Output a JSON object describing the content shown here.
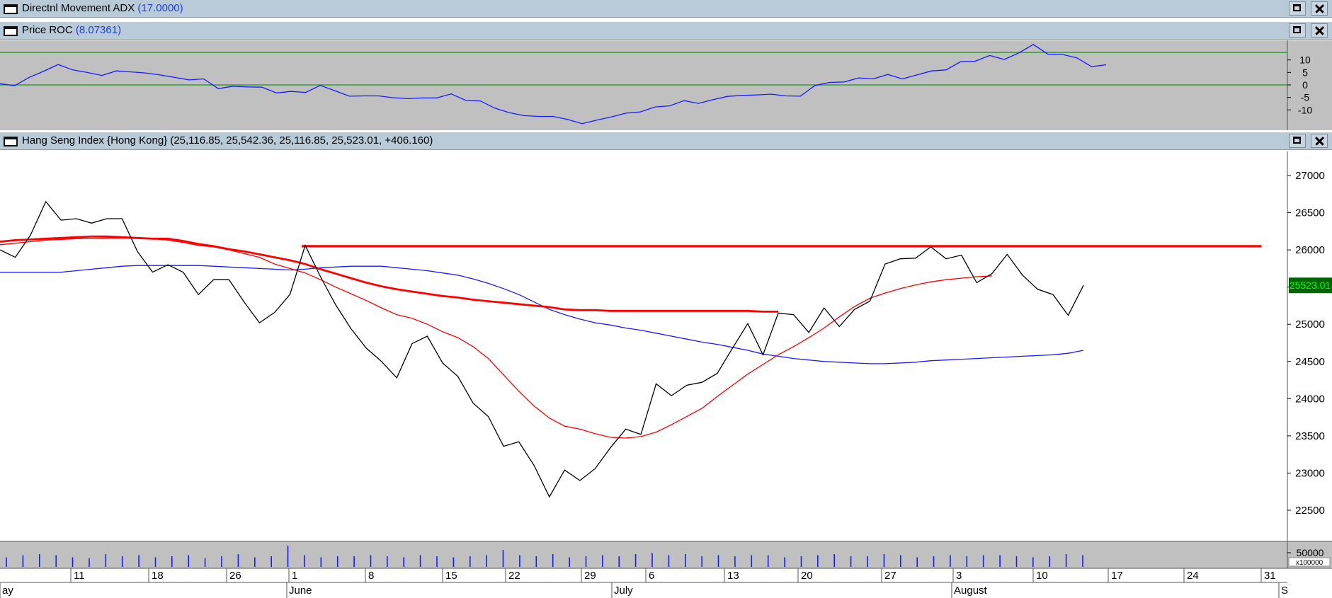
{
  "panes": [
    {
      "title": "Directnl Movement ADX",
      "value": "(17.0000)"
    },
    {
      "title": "Price ROC",
      "value": "(8.07361)"
    },
    {
      "title": "Hang Seng Index {Hong Kong}",
      "value": " (25,116.85, 25,542.36, 25,116.85, 25,523.01, +406.160)"
    }
  ],
  "colors": {
    "price": "#000000",
    "ma_blue": "#1a1aff",
    "ma_red": "#ff0000",
    "roc": "#1a1aff",
    "roc_bands": "#1f8f1f",
    "pane_bg_indicator": "#c0c0c0",
    "last_price_badge": "#006400",
    "last_price_text": "#00ff00"
  },
  "chart_data": [
    {
      "type": "line",
      "title": "Price ROC",
      "ylim": [
        -17,
        17
      ],
      "y_ticks": [
        "10",
        "5",
        "0",
        "-5",
        "-10"
      ],
      "reference_lines": [
        13,
        0
      ],
      "series": [
        {
          "values": [
            0.5,
            -0.3,
            3,
            5.5,
            8.2,
            6,
            5,
            3.8,
            5.6,
            5.2,
            4.8,
            4,
            3,
            2,
            2.4,
            -1.5,
            -0.5,
            -0.8,
            -0.9,
            -3.2,
            -2.6,
            -3,
            -0.2,
            -2.3,
            -4.5,
            -4.4,
            -4.4,
            -5.1,
            -5.5,
            -5.2,
            -5.2,
            -3.6,
            -6.2,
            -6.4,
            -9.3,
            -11.1,
            -12.3,
            -12.6,
            -12.6,
            -13.8,
            -15.5,
            -14.1,
            -12.8,
            -11.3,
            -10.8,
            -8.8,
            -8.4,
            -6.3,
            -7.4,
            -5.9,
            -4.6,
            -4.2,
            -4,
            -3.7,
            -4.4,
            -4.5,
            -0.2,
            1,
            1.2,
            2.8,
            2.4,
            4.2,
            2.4,
            4,
            5.6,
            6,
            9.3,
            9.5,
            11.8,
            10.2,
            12.8,
            16.2,
            12.3,
            12.2,
            10.8,
            7.3,
            8.07
          ]
        }
      ]
    },
    {
      "type": "line",
      "title": "Hang Seng Index {Hong Kong}",
      "ylim": [
        22050,
        27350
      ],
      "y_ticks": [
        "27000",
        "26500",
        "26000",
        "25500",
        "25000",
        "24500",
        "24000",
        "23500",
        "23000",
        "22500"
      ],
      "last_value_label": "25523.01",
      "series": [
        {
          "name": "Close",
          "values": [
            26000,
            25900,
            26200,
            26650,
            26400,
            26420,
            26360,
            26420,
            26420,
            25980,
            25700,
            25800,
            25700,
            25400,
            25600,
            25600,
            25300,
            25020,
            25160,
            25400,
            26060,
            25640,
            25260,
            24940,
            24680,
            24500,
            24280,
            24740,
            24840,
            24480,
            24300,
            23940,
            23760,
            23360,
            23420,
            23100,
            22680,
            23040,
            22900,
            23060,
            23340,
            23590,
            23520,
            24200,
            24040,
            24180,
            24220,
            24340,
            24680,
            25010,
            24590,
            25150,
            25130,
            24890,
            25220,
            24970,
            25200,
            25310,
            25810,
            25880,
            25890,
            26040,
            25880,
            25930,
            25560,
            25680,
            25940,
            25660,
            25470,
            25400,
            25120,
            25523
          ]
        },
        {
          "name": "MA blue",
          "values": [
            25700,
            25700,
            25700,
            25700,
            25700,
            25720,
            25740,
            25760,
            25780,
            25790,
            25790,
            25790,
            25790,
            25790,
            25780,
            25770,
            25760,
            25750,
            25740,
            25730,
            25740,
            25760,
            25770,
            25780,
            25780,
            25780,
            25760,
            25740,
            25720,
            25690,
            25660,
            25610,
            25550,
            25480,
            25400,
            25300,
            25200,
            25130,
            25070,
            25020,
            24990,
            24950,
            24920,
            24880,
            24840,
            24800,
            24760,
            24730,
            24690,
            24650,
            24600,
            24570,
            24540,
            24520,
            24500,
            24490,
            24480,
            24470,
            24470,
            24480,
            24490,
            24510,
            24520,
            24530,
            24540,
            24550,
            24560,
            24570,
            24580,
            24590,
            24610,
            24650
          ]
        },
        {
          "name": "MA red thin",
          "values": [
            26070,
            26090,
            26110,
            26130,
            26140,
            26150,
            26150,
            26160,
            26160,
            26160,
            26150,
            26130,
            26100,
            26060,
            26040,
            26000,
            25950,
            25900,
            25810,
            25750,
            25690,
            25600,
            25500,
            25410,
            25320,
            25220,
            25130,
            25080,
            25000,
            24900,
            24820,
            24700,
            24540,
            24320,
            24100,
            23900,
            23740,
            23630,
            23590,
            23530,
            23480,
            23470,
            23490,
            23550,
            23650,
            23760,
            23870,
            24030,
            24180,
            24330,
            24460,
            24590,
            24700,
            24820,
            24950,
            25100,
            25240,
            25350,
            25420,
            25480,
            25530,
            25570,
            25600,
            25620,
            25640,
            25650
          ]
        },
        {
          "name": "MA red thick",
          "values": [
            26110,
            26130,
            26140,
            26150,
            26160,
            26170,
            26180,
            26180,
            26170,
            26160,
            26150,
            26150,
            26120,
            26080,
            26050,
            26010,
            25980,
            25940,
            25900,
            25860,
            25810,
            25740,
            25680,
            25620,
            25560,
            25510,
            25470,
            25440,
            25410,
            25380,
            25360,
            25330,
            25310,
            25290,
            25270,
            25250,
            25230,
            25200,
            25190,
            25190,
            25180,
            25180,
            25180,
            25180,
            25180,
            25180,
            25180,
            25180,
            25180,
            25180,
            25170,
            25170
          ]
        },
        {
          "name": "Resistance",
          "values": [
            26050,
            26050
          ]
        }
      ]
    },
    {
      "type": "bar",
      "title": "Volume",
      "y_tick": "50000",
      "scale_label": "x100000",
      "values": [
        0.45,
        0.55,
        0.6,
        0.55,
        0.45,
        0.4,
        0.6,
        0.5,
        0.55,
        0.45,
        0.5,
        0.55,
        0.4,
        0.5,
        0.6,
        0.45,
        0.5,
        1.0,
        0.55,
        0.45,
        0.5,
        0.5,
        0.55,
        0.5,
        0.45,
        0.55,
        0.5,
        0.45,
        0.5,
        0.55,
        0.8,
        0.55,
        0.5,
        0.6,
        0.45,
        0.5,
        0.55,
        0.5,
        0.6,
        0.65,
        0.55,
        0.6,
        0.5,
        0.55,
        0.5,
        0.55,
        0.55,
        0.45,
        0.5,
        0.55,
        0.6,
        0.5,
        0.5,
        0.6,
        0.55,
        0.45,
        0.5,
        0.55,
        0.5,
        0.55,
        0.55,
        0.5,
        0.45,
        0.5,
        0.6,
        0.55
      ]
    }
  ],
  "x_axis": {
    "day_labels": [
      "11",
      "18",
      "26",
      "1",
      "8",
      "15",
      "22",
      "29",
      "6",
      "13",
      "20",
      "27",
      "3",
      "10",
      "17",
      "24",
      "31"
    ],
    "month_labels": [
      "ay",
      "June",
      "July",
      "August",
      "S"
    ]
  }
}
